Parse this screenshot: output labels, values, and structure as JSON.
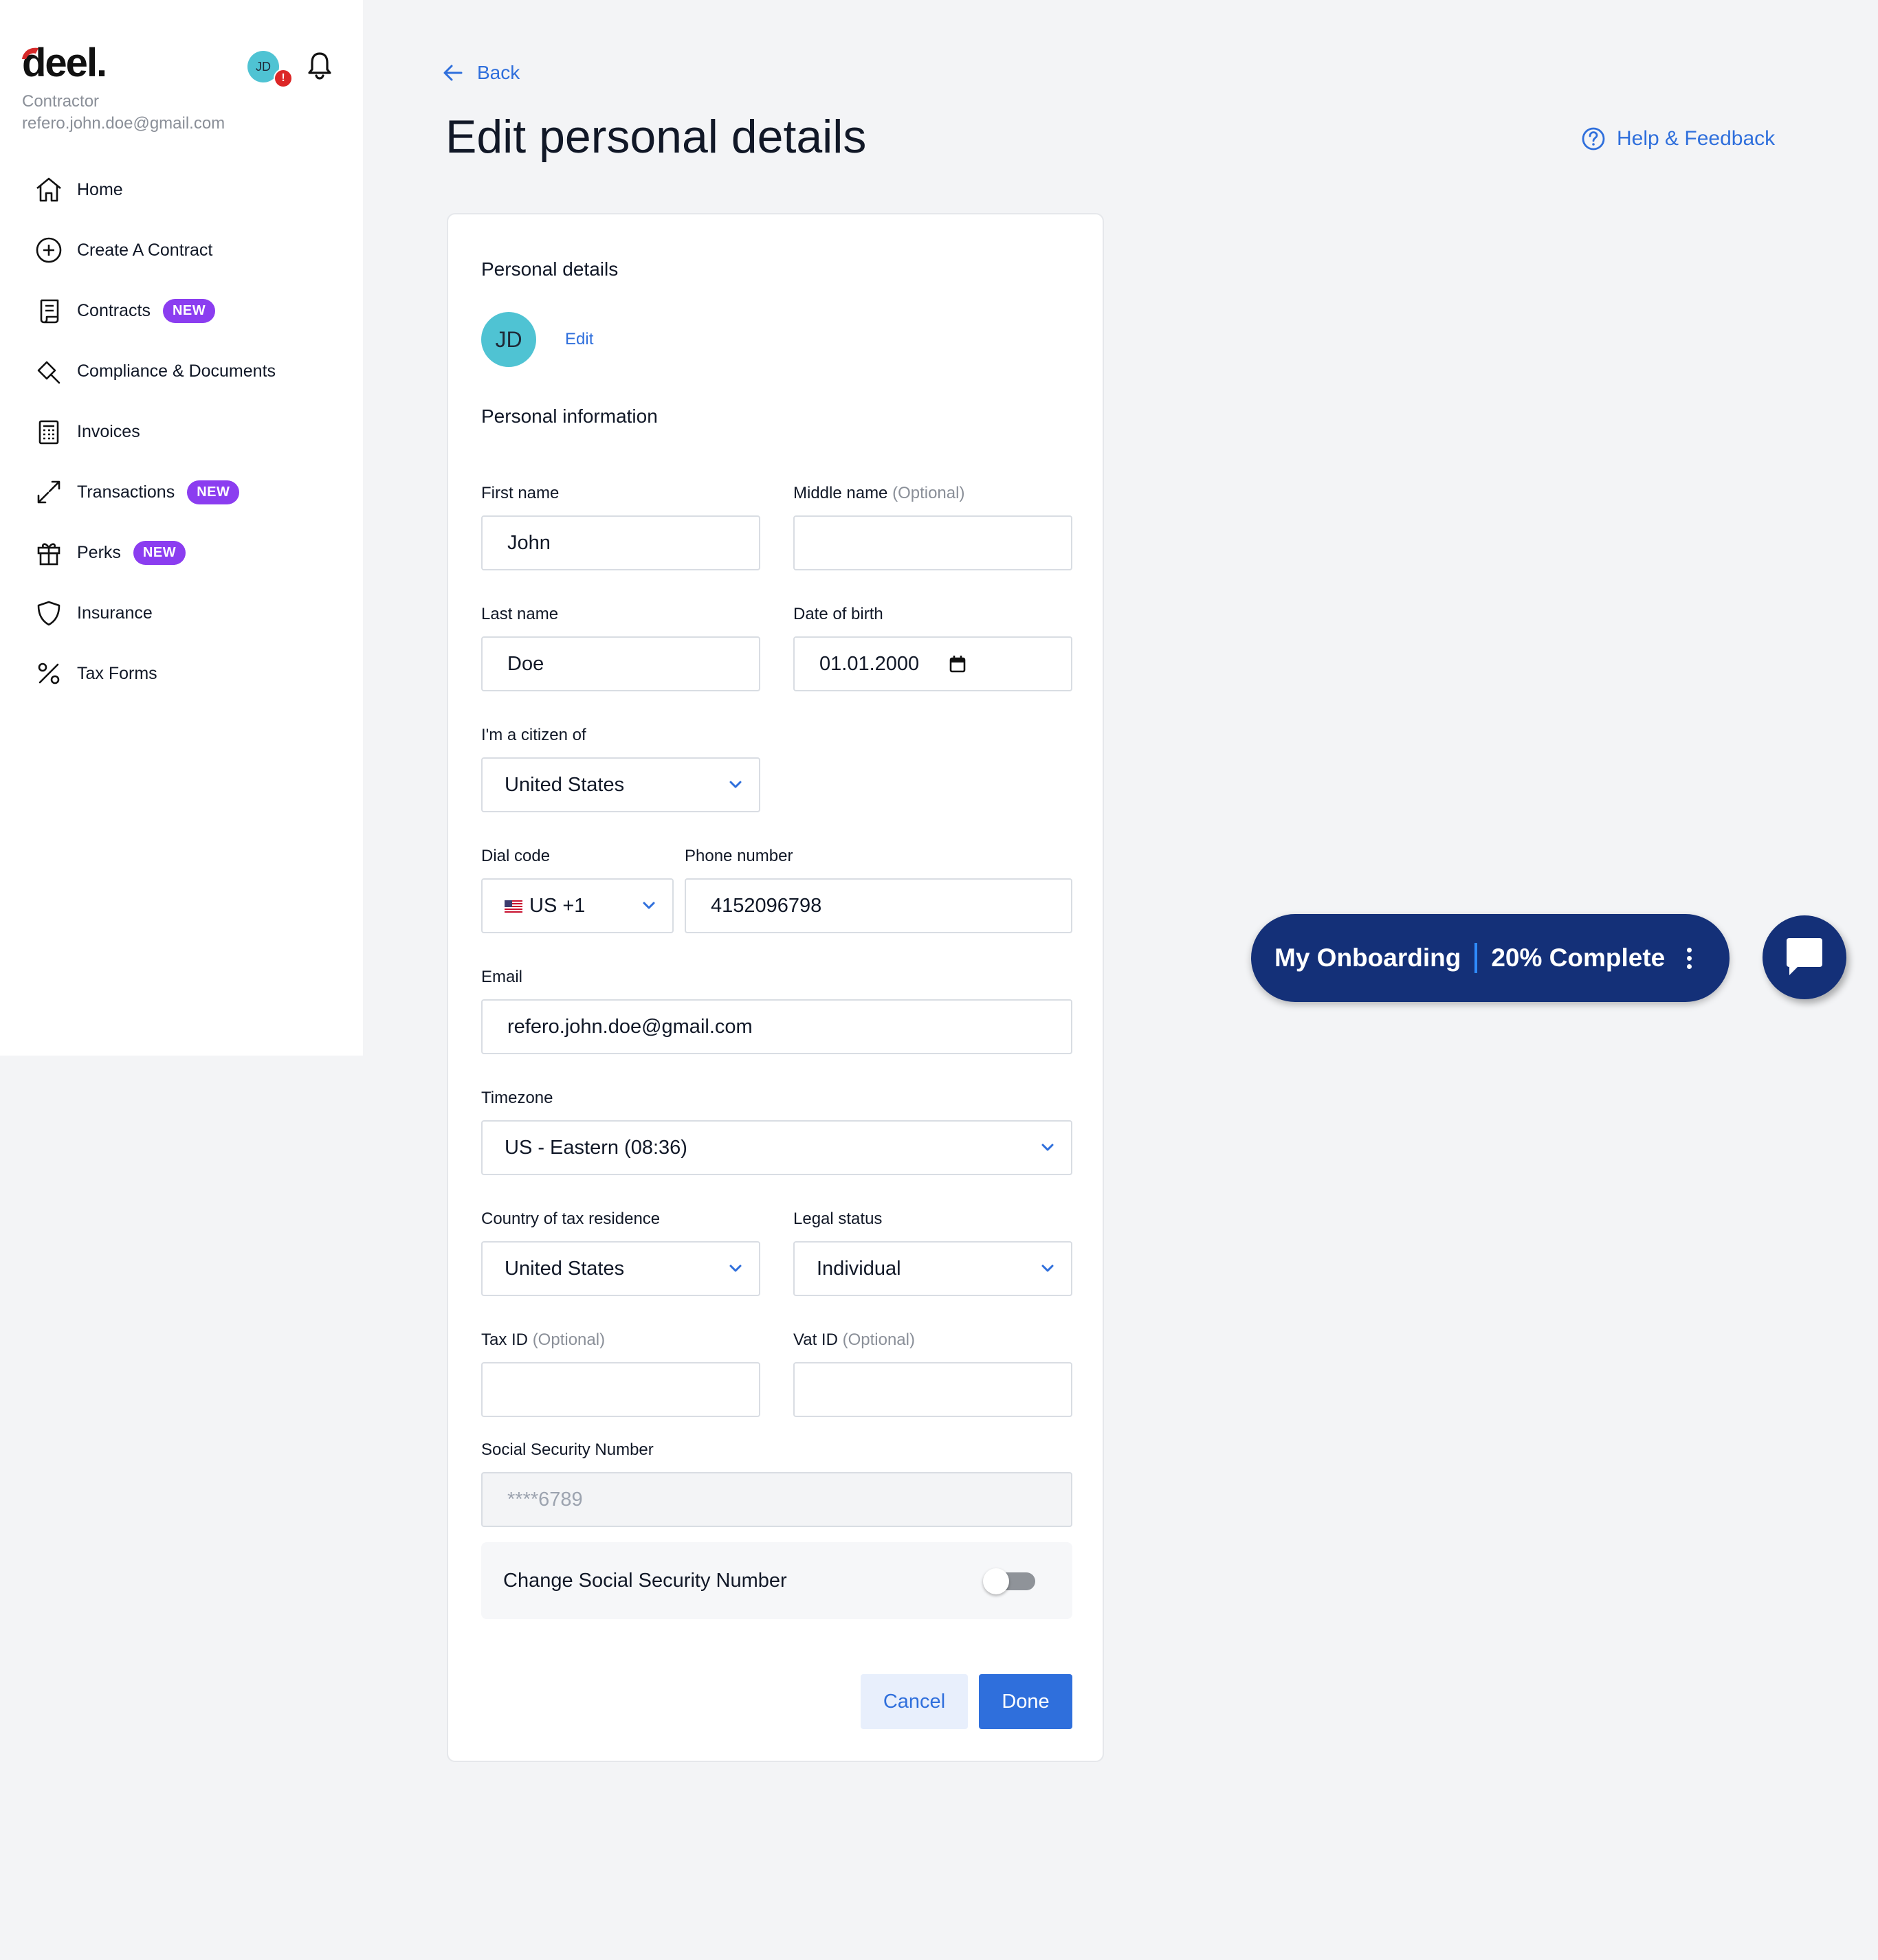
{
  "sidebar": {
    "brand": "deel.",
    "role": "Contractor",
    "user_email": "refero.john.doe@gmail.com",
    "avatar_initials": "JD",
    "alert_badge": "!",
    "items": [
      {
        "label": "Home",
        "icon": "home-icon"
      },
      {
        "label": "Create A Contract",
        "icon": "plus-circle-icon"
      },
      {
        "label": "Contracts",
        "icon": "contract-icon",
        "badge": "NEW"
      },
      {
        "label": "Compliance & Documents",
        "icon": "gavel-icon"
      },
      {
        "label": "Invoices",
        "icon": "invoice-icon"
      },
      {
        "label": "Transactions",
        "icon": "transfer-arrows-icon",
        "badge": "NEW"
      },
      {
        "label": "Perks",
        "icon": "gift-icon",
        "badge": "NEW"
      },
      {
        "label": "Insurance",
        "icon": "shield-icon"
      },
      {
        "label": "Tax Forms",
        "icon": "percent-icon"
      }
    ]
  },
  "header": {
    "back_label": "Back",
    "title": "Edit personal details",
    "help_label": "Help & Feedback"
  },
  "card": {
    "section_personal_details": "Personal details",
    "avatar_initials": "JD",
    "edit_label": "Edit",
    "section_personal_information": "Personal information",
    "optional_suffix": "(Optional)",
    "fields": {
      "first_name": {
        "label": "First name",
        "value": "John"
      },
      "middle_name": {
        "label": "Middle name",
        "value": ""
      },
      "last_name": {
        "label": "Last name",
        "value": "Doe"
      },
      "date_of_birth": {
        "label": "Date of birth",
        "value": "01.01.2000"
      },
      "citizenship": {
        "label": "I'm a citizen of",
        "value": "United States"
      },
      "dial_code": {
        "label": "Dial code",
        "value": "US +1"
      },
      "phone_number": {
        "label": "Phone number",
        "value": "4152096798"
      },
      "email": {
        "label": "Email",
        "value": "refero.john.doe@gmail.com"
      },
      "timezone": {
        "label": "Timezone",
        "value": "US - Eastern (08:36)"
      },
      "tax_residence": {
        "label": "Country of tax residence",
        "value": "United States"
      },
      "legal_status": {
        "label": "Legal status",
        "value": "Individual"
      },
      "tax_id": {
        "label": "Tax ID",
        "value": ""
      },
      "vat_id": {
        "label": "Vat ID",
        "value": ""
      },
      "ssn": {
        "label": "Social Security Number",
        "value": "****6789"
      }
    },
    "change_ssn_label": "Change Social Security Number",
    "change_ssn_enabled": false,
    "cancel_label": "Cancel",
    "done_label": "Done"
  },
  "onboarding": {
    "title": "My Onboarding",
    "progress": "20% Complete"
  },
  "colors": {
    "accent": "#2f6fdc",
    "badge": "#8b3df0",
    "onboarding_bg": "#143078",
    "avatar": "#4fc3d3",
    "alert": "#dc2626"
  }
}
